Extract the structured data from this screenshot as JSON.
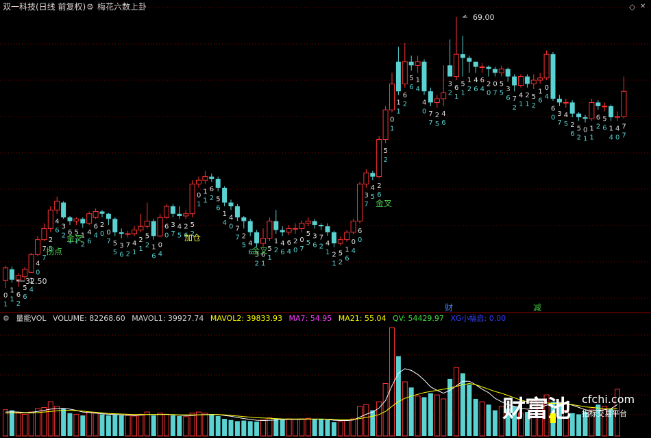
{
  "title": {
    "symbol": "双一科技(日线 前复权)",
    "indicator": "梅花六数上卦",
    "diamond": "◇"
  },
  "price_labels": {
    "high": "69.00",
    "low": "32.50"
  },
  "annotations": [
    {
      "text": "拐点",
      "color": "#4dd04d"
    },
    {
      "text": "金叉",
      "color": "#4dd04d"
    },
    {
      "text": "加仓",
      "color": "#e8e840"
    },
    {
      "text": "金叉",
      "color": "#4dd04d"
    },
    {
      "text": "金叉",
      "color": "#4dd04d"
    }
  ],
  "markers": [
    {
      "text": "财",
      "color": "#4080ff"
    },
    {
      "text": "减",
      "color": "#40c040"
    }
  ],
  "volume_header": {
    "name": "量能VOL",
    "volume": "VOLUME: 82268.60",
    "mavol1": "MAVOL1: 39927.74",
    "mavol2": "MAVOL2: 39833.93",
    "ma7": "MA7: 54.95",
    "ma21": "MA21: 55.04",
    "qv": "QV: 54429.97",
    "xg": "XG小幅启: 0.00"
  },
  "colors": {
    "up": "#ff3333",
    "down": "#5ad2d2",
    "grid": "#8b0000",
    "mavol1": "#ffffff",
    "mavol2": "#ffff00"
  },
  "watermark": {
    "brand": "财富池",
    "domain": "cfchi.com",
    "slogan": "指标交易平台"
  },
  "candles": [
    [
      33.5,
      35.2,
      32.5,
      35.5
    ],
    [
      35.0,
      33.6,
      33.2,
      35.4
    ],
    [
      33.6,
      34.2,
      32.6,
      34.5
    ],
    [
      34.0,
      35.0,
      33.5,
      35.3
    ],
    [
      34.6,
      37.0,
      34.5,
      37.2
    ],
    [
      37.0,
      39.0,
      36.8,
      39.5
    ],
    [
      39.0,
      40.5,
      38.8,
      41.2
    ],
    [
      40.5,
      43.0,
      40.0,
      43.5
    ],
    [
      43.0,
      44.2,
      42.5,
      44.8
    ],
    [
      44.0,
      42.0,
      41.8,
      44.2
    ],
    [
      42.0,
      41.5,
      41.0,
      42.2
    ],
    [
      41.5,
      41.8,
      41.0,
      42.0
    ],
    [
      41.8,
      41.2,
      40.6,
      42.0
    ],
    [
      41.2,
      42.5,
      41.0,
      42.8
    ],
    [
      42.0,
      42.8,
      41.8,
      43.2
    ],
    [
      42.8,
      42.5,
      42.0,
      43.0
    ],
    [
      42.5,
      41.8,
      41.0,
      42.6
    ],
    [
      41.8,
      40.0,
      39.5,
      42.0
    ],
    [
      40.0,
      39.8,
      39.2,
      40.5
    ],
    [
      39.8,
      39.8,
      39.3,
      40.2
    ],
    [
      39.8,
      40.3,
      39.5,
      40.8
    ],
    [
      40.3,
      40.8,
      40.0,
      42.5
    ],
    [
      40.8,
      41.5,
      40.5,
      44.0
    ],
    [
      41.5,
      39.5,
      39.0,
      41.8
    ],
    [
      39.5,
      42.0,
      39.3,
      42.5
    ],
    [
      42.0,
      43.5,
      41.8,
      43.8
    ],
    [
      43.5,
      42.5,
      42.0,
      43.8
    ],
    [
      42.5,
      42.2,
      41.8,
      43.5
    ],
    [
      42.2,
      42.5,
      41.8,
      43.0
    ],
    [
      42.5,
      46.5,
      42.0,
      47.0
    ],
    [
      46.5,
      47.0,
      46.0,
      47.5
    ],
    [
      47.0,
      47.5,
      46.5,
      48.3
    ],
    [
      47.5,
      47.2,
      46.8,
      47.9
    ],
    [
      47.2,
      46.0,
      45.5,
      47.5
    ],
    [
      46.0,
      44.0,
      43.5,
      46.2
    ],
    [
      44.0,
      43.5,
      43.0,
      44.4
    ],
    [
      43.5,
      42.0,
      41.5,
      43.8
    ],
    [
      42.0,
      41.5,
      40.5,
      42.2
    ],
    [
      41.5,
      40.0,
      39.5,
      41.8
    ],
    [
      40.0,
      38.5,
      38.0,
      40.3
    ],
    [
      38.5,
      39.2,
      38.0,
      40.5
    ],
    [
      39.2,
      41.5,
      38.8,
      42.0
    ],
    [
      41.5,
      40.3,
      39.8,
      43.0
    ],
    [
      40.3,
      40.0,
      39.5,
      40.8
    ],
    [
      40.0,
      40.5,
      39.6,
      41.0
    ],
    [
      40.5,
      40.5,
      39.8,
      41.2
    ],
    [
      40.5,
      41.2,
      40.0,
      41.6
    ],
    [
      41.2,
      41.5,
      40.8,
      42.0
    ],
    [
      41.5,
      41.0,
      40.5,
      41.8
    ],
    [
      41.0,
      40.8,
      40.3,
      41.2
    ],
    [
      40.8,
      40.0,
      39.5,
      41.2
    ],
    [
      40.0,
      38.5,
      38.0,
      40.2
    ],
    [
      38.5,
      39.0,
      38.2,
      39.4
    ],
    [
      39.0,
      40.0,
      38.7,
      40.3
    ],
    [
      40.0,
      41.5,
      39.7,
      41.8
    ],
    [
      41.5,
      46.5,
      41.2,
      46.8
    ],
    [
      46.5,
      48.0,
      46.0,
      48.5
    ],
    [
      48.0,
      47.5,
      47.0,
      48.3
    ],
    [
      47.5,
      52.5,
      47.3,
      53.0
    ],
    [
      52.5,
      56.5,
      52.0,
      57.0
    ],
    [
      56.5,
      60.0,
      56.2,
      61.5
    ],
    [
      63.0,
      59.0,
      58.5,
      65.0
    ],
    [
      60.0,
      63.0,
      59.5,
      65.5
    ],
    [
      63.0,
      62.5,
      61.8,
      63.8
    ],
    [
      62.5,
      63.0,
      61.5,
      63.8
    ],
    [
      63.0,
      59.0,
      58.5,
      63.3
    ],
    [
      59.0,
      57.5,
      57.0,
      59.5
    ],
    [
      57.5,
      58.0,
      56.8,
      58.5
    ],
    [
      58.0,
      58.8,
      57.0,
      62.5
    ],
    [
      62.5,
      61.0,
      61.0,
      66.0
    ],
    [
      61.0,
      64.0,
      60.5,
      69.0
    ],
    [
      64.0,
      63.5,
      61.0,
      66.5
    ],
    [
      63.5,
      63.0,
      61.5,
      63.8
    ],
    [
      63.0,
      62.3,
      61.5,
      62.8
    ],
    [
      62.3,
      62.3,
      61.5,
      62.8
    ],
    [
      62.3,
      62.0,
      61.0,
      62.5
    ],
    [
      62.0,
      61.5,
      61.0,
      62.3
    ],
    [
      61.5,
      62.0,
      61.0,
      62.5
    ],
    [
      62.0,
      61.0,
      60.3,
      62.2
    ],
    [
      61.0,
      59.8,
      59.0,
      61.3
    ],
    [
      59.8,
      61.0,
      59.5,
      61.3
    ],
    [
      61.0,
      60.0,
      59.5,
      61.3
    ],
    [
      60.0,
      60.5,
      59.3,
      61.3
    ],
    [
      60.5,
      60.8,
      60.0,
      61.5
    ],
    [
      60.8,
      64.0,
      60.5,
      64.5
    ],
    [
      64.0,
      58.0,
      57.7,
      64.3
    ],
    [
      58.0,
      57.5,
      57.0,
      58.5
    ],
    [
      57.5,
      57.5,
      56.8,
      58.0
    ],
    [
      57.5,
      56.0,
      55.5,
      57.8
    ],
    [
      56.0,
      55.5,
      55.0,
      56.2
    ],
    [
      55.5,
      55.3,
      54.8,
      55.8
    ],
    [
      55.3,
      57.5,
      55.0,
      58.0
    ],
    [
      57.5,
      57.0,
      56.5,
      57.8
    ],
    [
      57.0,
      57.0,
      56.3,
      57.5
    ],
    [
      57.0,
      55.5,
      55.0,
      57.2
    ],
    [
      55.5,
      55.6,
      55.0,
      56.3
    ],
    [
      55.6,
      59.0,
      55.3,
      61.0
    ]
  ],
  "volumes": [
    46000,
    45000,
    40000,
    38000,
    42000,
    48000,
    50000,
    60000,
    52000,
    48000,
    40000,
    38000,
    36000,
    42000,
    40000,
    38000,
    36000,
    37000,
    36000,
    36000,
    35000,
    38000,
    42000,
    36000,
    40000,
    38000,
    36000,
    35000,
    34000,
    40000,
    42000,
    40000,
    38000,
    35000,
    30000,
    28000,
    26000,
    27000,
    26000,
    25000,
    28000,
    32000,
    30000,
    29000,
    30000,
    29000,
    30000,
    31000,
    29000,
    29000,
    28000,
    24000,
    25000,
    27000,
    30000,
    52000,
    55000,
    45000,
    60000,
    92000,
    190000,
    140000,
    95000,
    85000,
    70000,
    68000,
    75000,
    72000,
    65000,
    100000,
    120000,
    110000,
    90000,
    65000,
    60000,
    55000,
    45000,
    52000,
    48000,
    52000,
    40000,
    42000,
    62000,
    58000,
    72000,
    60000,
    58000,
    45000,
    40000,
    38000,
    42000,
    47000,
    55000,
    52000,
    48000,
    82000
  ],
  "mavol1": [
    42000,
    42500,
    42000,
    41000,
    41500,
    43000,
    45000,
    47000,
    48000,
    48500,
    47000,
    45000,
    42000,
    41000,
    40000,
    39000,
    38000,
    37500,
    37000,
    36500,
    36000,
    36500,
    37500,
    37500,
    37800,
    38000,
    37000,
    36500,
    36000,
    36000,
    37000,
    37500,
    37800,
    37500,
    36000,
    34500,
    32500,
    30500,
    29000,
    27500,
    27000,
    27500,
    28000,
    28500,
    29000,
    29000,
    29000,
    29500,
    29500,
    29500,
    29000,
    27500,
    27000,
    27000,
    28000,
    33000,
    38000,
    42000,
    49000,
    62000,
    88000,
    110000,
    118000,
    115000,
    108000,
    98000,
    86000,
    80000,
    75000,
    80000,
    88000,
    96000,
    96000,
    90000,
    82000,
    76000,
    66000,
    60000,
    55000,
    52000,
    49000,
    47000,
    48000,
    50000,
    54000,
    57000,
    59000,
    57000,
    54000,
    50000,
    46000,
    44000,
    44500,
    46000,
    48000,
    55000
  ],
  "mavol2": [
    40000,
    40500,
    40500,
    40500,
    40500,
    41000,
    42000,
    43000,
    44000,
    45000,
    45000,
    44500,
    43500,
    42500,
    41500,
    40500,
    39500,
    39000,
    38500,
    38000,
    37500,
    37500,
    37500,
    37500,
    37500,
    37500,
    37500,
    37000,
    37000,
    37000,
    37000,
    37200,
    37500,
    37500,
    37000,
    36000,
    35000,
    34000,
    33000,
    32000,
    31500,
    31000,
    30500,
    30000,
    29800,
    29700,
    29700,
    29800,
    29800,
    29800,
    29500,
    29000,
    28700,
    28500,
    28800,
    30500,
    32500,
    34500,
    37500,
    43000,
    52000,
    60000,
    66000,
    70000,
    73000,
    76000,
    78000,
    80000,
    82000,
    84000,
    87000,
    90000,
    92000,
    90000,
    86000,
    82000,
    78000,
    75000,
    71000,
    67000,
    63000,
    60000,
    59000,
    58000,
    58000,
    57000,
    57000,
    56000,
    55000,
    53000,
    51000,
    50000,
    49000,
    48000,
    47000,
    48000
  ]
}
